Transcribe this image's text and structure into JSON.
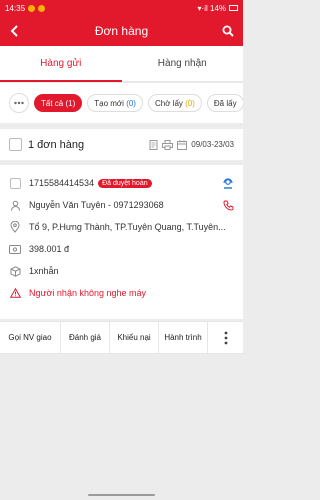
{
  "status_bar": {
    "time": "14:35",
    "right": "▾·il 14%"
  },
  "header": {
    "title": "Đơn hàng"
  },
  "tabs": [
    {
      "label": "Hàng gửi",
      "active": true
    },
    {
      "label": "Hàng nhận",
      "active": false
    }
  ],
  "filters": [
    {
      "label": "Tất cả",
      "count": "(1)",
      "active": true
    },
    {
      "label": "Tạo mới",
      "count": "(0)",
      "active": false
    },
    {
      "label": "Chờ lấy",
      "count": "(0)",
      "active": false
    },
    {
      "label": "Đã lấy",
      "count": "",
      "active": false
    }
  ],
  "summary": {
    "count_label": "1 đơn hàng",
    "date_range": "09/03-23/03"
  },
  "order": {
    "code": "1715584414534",
    "status_badge": "Đã duyệt hoàn",
    "recipient": "Nguyễn Văn Tuyên - 0971293068",
    "address": "Tổ 9, P.Hưng Thành, TP.Tuyên Quang, T.Tuyên...",
    "amount": "398.001 đ",
    "package": "1xnhẫn",
    "warning": "Người nhận không nghe máy"
  },
  "actions": [
    "Gọi NV giao",
    "Đánh giá",
    "Khiếu nại",
    "Hành trình"
  ],
  "colors": {
    "brand": "#e2192c",
    "blue": "#1e73d8",
    "yellow": "#e0a800"
  }
}
